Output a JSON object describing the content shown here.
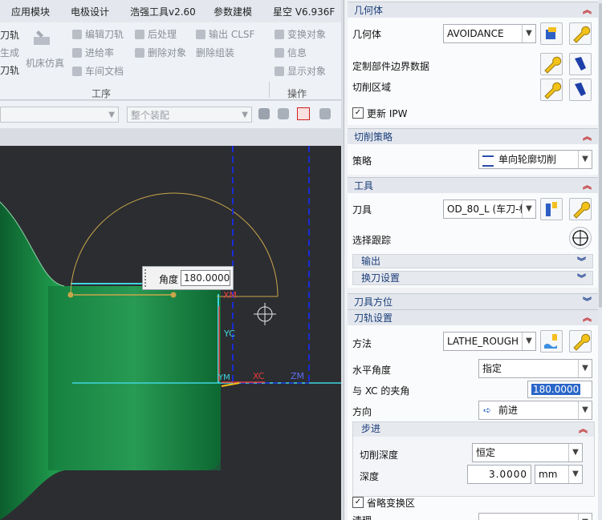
{
  "menubar": {
    "items": [
      "应用模块",
      "电极设计",
      "浩强工具v2.60",
      "参数建模",
      "星空 V6.936F"
    ]
  },
  "ribbon": {
    "left_partial": [
      "刀轨",
      "生成",
      "刀轨"
    ],
    "machine_sim": "机床仿真",
    "col2": [
      "编辑刀轨",
      "进给率",
      "车间文档"
    ],
    "col3": [
      "后处理",
      "删除对象"
    ],
    "col4": [
      "输出 CLSF",
      "删除组装"
    ],
    "col5": [
      "变换对象",
      "信息",
      "显示对象"
    ],
    "group_work": "工序",
    "group_op": "操作"
  },
  "toolbar2": {
    "combo1": "",
    "combo2": "整个装配"
  },
  "viewport": {
    "angle_label": "角度",
    "angle_value": "180.00000",
    "axis_labels": [
      "XM",
      "YC",
      "YM",
      "XC",
      "ZM"
    ]
  },
  "panel": {
    "geometry": {
      "title": "几何体",
      "geometry_label": "几何体",
      "geometry_value": "AVOIDANCE",
      "custom_boundary": "定制部件边界数据",
      "cut_region": "切削区域",
      "update_ipw": "更新 IPW"
    },
    "strategy": {
      "title": "切削策略",
      "strategy_label": "策略",
      "strategy_value": "单向轮廓切削"
    },
    "tool": {
      "title": "工具",
      "tool_label": "刀具",
      "tool_value": "OD_80_L (车刀-标",
      "tracking": "选择跟踪",
      "output": "输出",
      "tool_change": "换刀设置"
    },
    "tool_orient": {
      "title": "刀具方位"
    },
    "path": {
      "title": "刀轨设置",
      "method_label": "方法",
      "method_value": "LATHE_ROUGH",
      "h_angle_label": "水平角度",
      "h_angle_value": "指定",
      "xc_angle_label": "与 XC 的夹角",
      "xc_angle_value": "180.0000",
      "direction_label": "方向",
      "direction_value": "前进",
      "step": {
        "title": "步进",
        "depth_mode_label": "切削深度",
        "depth_mode_value": "恒定",
        "depth_label": "深度",
        "depth_value": "3.0000",
        "unit": "mm"
      },
      "omit_transform": "省略变换区",
      "cleanup_partial": "清理"
    }
  },
  "colors": {
    "part_green": "#0f7a3a",
    "path_cyan": "#3fd6e0",
    "dashed_blue": "#1a2bd6",
    "arc_gold": "#c9a64a"
  }
}
